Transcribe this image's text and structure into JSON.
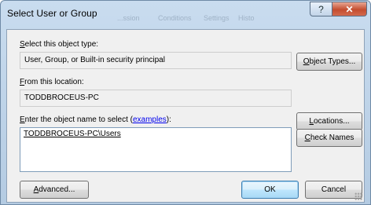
{
  "window": {
    "title": "Select User or Group",
    "ghost_tabs": [
      "...ssion",
      "Conditions",
      "Settings",
      "Histo"
    ],
    "help_symbol": "?",
    "close_symbol": "✕"
  },
  "object_type": {
    "label_key": "S",
    "label_rest": "elect this object type:",
    "value": "User, Group, or Built-in security principal",
    "button_key": "O",
    "button_rest": "bject Types..."
  },
  "location": {
    "label_key": "F",
    "label_rest": "rom this location:",
    "value": "TODDBROCEUS-PC",
    "button_key": "L",
    "button_rest": "ocations..."
  },
  "object_name": {
    "label_key": "E",
    "label_rest": "nter the object name to select (",
    "label_link": "examples",
    "label_end": "):",
    "value": "TODDBROCEUS-PC\\Users",
    "check_key": "C",
    "check_rest": "heck Names"
  },
  "footer": {
    "advanced_key": "A",
    "advanced_rest": "dvanced...",
    "ok_label": "OK",
    "cancel_label": "Cancel"
  }
}
